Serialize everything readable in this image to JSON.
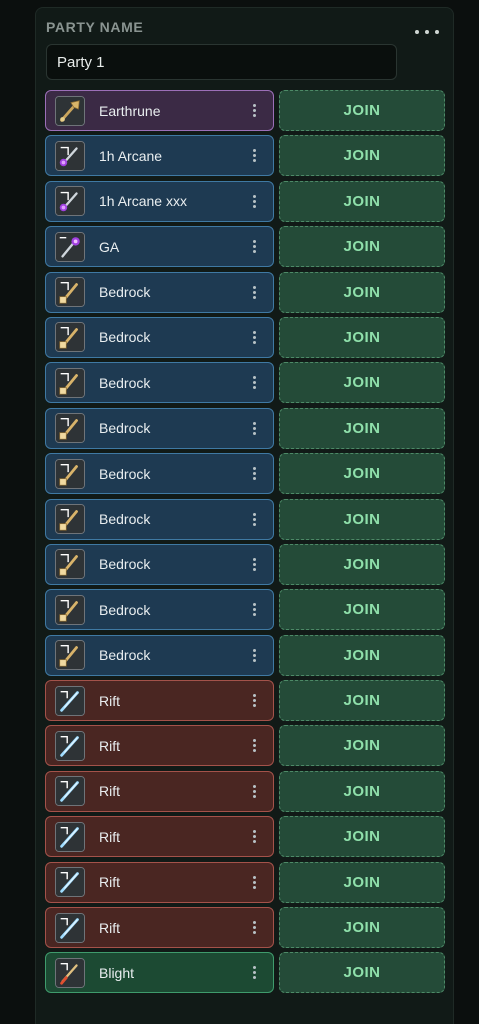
{
  "party": {
    "label": "PARTY NAME",
    "name_value": "Party 1"
  },
  "join_label": "JOIN",
  "members": [
    {
      "name": "Earthrune",
      "style": "purple",
      "icon": "earthrune-weapon-icon"
    },
    {
      "name": "1h Arcane",
      "style": "blue",
      "icon": "arcane-staff-icon"
    },
    {
      "name": "1h Arcane xxx",
      "style": "blue",
      "icon": "arcane-staff-icon"
    },
    {
      "name": "GA",
      "style": "blue",
      "icon": "great-arcane-staff-icon"
    },
    {
      "name": "Bedrock",
      "style": "blue",
      "icon": "bedrock-mace-icon"
    },
    {
      "name": "Bedrock",
      "style": "blue",
      "icon": "bedrock-mace-icon"
    },
    {
      "name": "Bedrock",
      "style": "blue",
      "icon": "bedrock-mace-icon"
    },
    {
      "name": "Bedrock",
      "style": "blue",
      "icon": "bedrock-mace-icon"
    },
    {
      "name": "Bedrock",
      "style": "blue",
      "icon": "bedrock-mace-icon"
    },
    {
      "name": "Bedrock",
      "style": "blue",
      "icon": "bedrock-mace-icon"
    },
    {
      "name": "Bedrock",
      "style": "blue",
      "icon": "bedrock-mace-icon"
    },
    {
      "name": "Bedrock",
      "style": "blue",
      "icon": "bedrock-mace-icon"
    },
    {
      "name": "Bedrock",
      "style": "blue",
      "icon": "bedrock-mace-icon"
    },
    {
      "name": "Rift",
      "style": "red",
      "icon": "rift-glaive-icon"
    },
    {
      "name": "Rift",
      "style": "red",
      "icon": "rift-glaive-icon"
    },
    {
      "name": "Rift",
      "style": "red",
      "icon": "rift-glaive-icon"
    },
    {
      "name": "Rift",
      "style": "red",
      "icon": "rift-glaive-icon"
    },
    {
      "name": "Rift",
      "style": "red",
      "icon": "rift-glaive-icon"
    },
    {
      "name": "Rift",
      "style": "red",
      "icon": "rift-glaive-icon"
    },
    {
      "name": "Blight",
      "style": "green",
      "icon": "blight-staff-icon"
    }
  ],
  "colors": {
    "purple": "#3b2a45",
    "blue": "#1e3a52",
    "red": "#4a2622",
    "green": "#1c4a33",
    "join_text": "#8fe0ab"
  }
}
